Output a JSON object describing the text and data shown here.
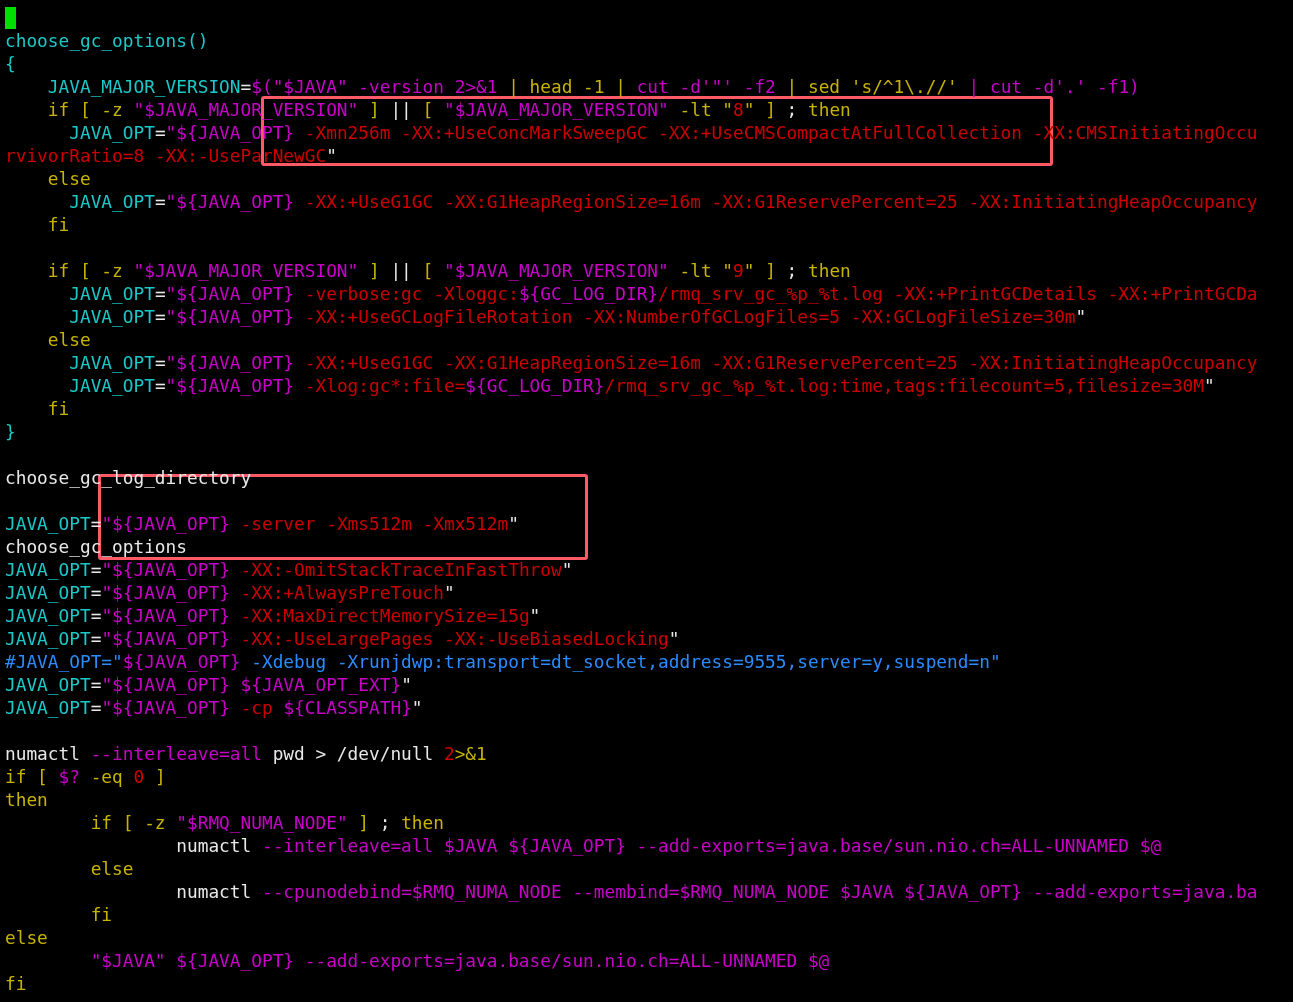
{
  "editor": {
    "cursor_visible": true,
    "lines": [
      {
        "segments": [
          {
            "kind": "fn",
            "text": "choose_gc_options()"
          }
        ]
      },
      {
        "segments": [
          {
            "kind": "fn",
            "text": "{"
          }
        ]
      },
      {
        "segments": [
          {
            "kind": "ident",
            "text": "    JAVA_MAJOR_VERSION"
          },
          {
            "kind": "op",
            "text": "="
          },
          {
            "kind": "str",
            "text": "$(\"$JAVA\" -version 2>&1"
          },
          {
            "kind": "kw",
            "text": " | head -1 | "
          },
          {
            "kind": "str",
            "text": "cut -d'\"' -f2 "
          },
          {
            "kind": "kw",
            "text": "| sed 's/^1\\.//' "
          },
          {
            "kind": "str",
            "text": "| cut -d'.' -f1)"
          }
        ]
      },
      {
        "segments": [
          {
            "kind": "kw",
            "text": "    if [ -z "
          },
          {
            "kind": "str",
            "text": "\"$JAVA_MAJOR_VERSION\""
          },
          {
            "kind": "kw",
            "text": " ] "
          },
          {
            "kind": "op",
            "text": "||"
          },
          {
            "kind": "kw",
            "text": " [ "
          },
          {
            "kind": "str",
            "text": "\"$JAVA_MAJOR_VERSION\""
          },
          {
            "kind": "kw",
            "text": " -lt \""
          },
          {
            "kind": "num",
            "text": "8"
          },
          {
            "kind": "kw",
            "text": "\" ] "
          },
          {
            "kind": "op",
            "text": "; "
          },
          {
            "kind": "kw",
            "text": "then"
          }
        ]
      },
      {
        "segments": [
          {
            "kind": "ident",
            "text": "      JAVA_OPT"
          },
          {
            "kind": "op",
            "text": "="
          },
          {
            "kind": "str",
            "text": "\"${JAVA_OPT}"
          },
          {
            "kind": "opt",
            "text": " -Xmn256m -XX:+UseConcMarkSweepGC -XX:+UseCMSCompactAtFullCollection -XX:CMSInitiatingOccu"
          }
        ]
      },
      {
        "segments": [
          {
            "kind": "opt",
            "text": "rvivorRatio=8 -XX:-UseParNewGC"
          },
          {
            "kind": "op",
            "text": "\""
          }
        ]
      },
      {
        "segments": [
          {
            "kind": "kw",
            "text": "    else"
          }
        ]
      },
      {
        "segments": [
          {
            "kind": "ident",
            "text": "      JAVA_OPT"
          },
          {
            "kind": "op",
            "text": "="
          },
          {
            "kind": "str",
            "text": "\"${JAVA_OPT}"
          },
          {
            "kind": "opt",
            "text": " -XX:+UseG1GC -XX:G1HeapRegionSize=16m -XX:G1ReservePercent=25 -XX:InitiatingHeapOccupancy"
          }
        ]
      },
      {
        "segments": [
          {
            "kind": "kw",
            "text": "    fi"
          }
        ]
      },
      {
        "kind": "blank"
      },
      {
        "segments": [
          {
            "kind": "kw",
            "text": "    if [ -z "
          },
          {
            "kind": "str",
            "text": "\"$JAVA_MAJOR_VERSION\""
          },
          {
            "kind": "kw",
            "text": " ] "
          },
          {
            "kind": "op",
            "text": "||"
          },
          {
            "kind": "kw",
            "text": " [ "
          },
          {
            "kind": "str",
            "text": "\"$JAVA_MAJOR_VERSION\""
          },
          {
            "kind": "kw",
            "text": " -lt \""
          },
          {
            "kind": "num",
            "text": "9"
          },
          {
            "kind": "kw",
            "text": "\" ] "
          },
          {
            "kind": "op",
            "text": "; "
          },
          {
            "kind": "kw",
            "text": "then"
          }
        ]
      },
      {
        "segments": [
          {
            "kind": "ident",
            "text": "      JAVA_OPT"
          },
          {
            "kind": "op",
            "text": "="
          },
          {
            "kind": "str",
            "text": "\"${JAVA_OPT}"
          },
          {
            "kind": "opt",
            "text": " -verbose:gc -Xloggc:"
          },
          {
            "kind": "str",
            "text": "${GC_LOG_DIR}"
          },
          {
            "kind": "opt",
            "text": "/rmq_srv_gc_%p_%t.log -XX:+PrintGCDetails -XX:+PrintGCDa"
          }
        ]
      },
      {
        "segments": [
          {
            "kind": "ident",
            "text": "      JAVA_OPT"
          },
          {
            "kind": "op",
            "text": "="
          },
          {
            "kind": "str",
            "text": "\"${JAVA_OPT}"
          },
          {
            "kind": "opt",
            "text": " -XX:+UseGCLogFileRotation -XX:NumberOfGCLogFiles=5 -XX:GCLogFileSize=30m"
          },
          {
            "kind": "op",
            "text": "\""
          }
        ]
      },
      {
        "segments": [
          {
            "kind": "kw",
            "text": "    else"
          }
        ]
      },
      {
        "segments": [
          {
            "kind": "ident",
            "text": "      JAVA_OPT"
          },
          {
            "kind": "op",
            "text": "="
          },
          {
            "kind": "str",
            "text": "\"${JAVA_OPT}"
          },
          {
            "kind": "opt",
            "text": " -XX:+UseG1GC -XX:G1HeapRegionSize=16m -XX:G1ReservePercent=25 -XX:InitiatingHeapOccupancy"
          }
        ]
      },
      {
        "segments": [
          {
            "kind": "ident",
            "text": "      JAVA_OPT"
          },
          {
            "kind": "op",
            "text": "="
          },
          {
            "kind": "str",
            "text": "\"${JAVA_OPT}"
          },
          {
            "kind": "opt",
            "text": " -Xlog:gc*:file="
          },
          {
            "kind": "str",
            "text": "${GC_LOG_DIR}"
          },
          {
            "kind": "opt",
            "text": "/rmq_srv_gc_%p_%t.log:time,tags:filecount=5,filesize=30M"
          },
          {
            "kind": "op",
            "text": "\""
          }
        ]
      },
      {
        "segments": [
          {
            "kind": "kw",
            "text": "    fi"
          }
        ]
      },
      {
        "segments": [
          {
            "kind": "fn",
            "text": "}"
          }
        ]
      },
      {
        "kind": "blank"
      },
      {
        "segments": [
          {
            "kind": "plain",
            "text": "choose_gc_log_directory"
          }
        ]
      },
      {
        "kind": "blank"
      },
      {
        "segments": [
          {
            "kind": "ident",
            "text": "JAVA_OPT"
          },
          {
            "kind": "op",
            "text": "="
          },
          {
            "kind": "str",
            "text": "\"${JAVA_OPT}"
          },
          {
            "kind": "opt",
            "text": " -server -Xms512m -Xmx512m"
          },
          {
            "kind": "op",
            "text": "\""
          }
        ]
      },
      {
        "segments": [
          {
            "kind": "plain",
            "text": "choose_gc_options"
          }
        ]
      },
      {
        "segments": [
          {
            "kind": "ident",
            "text": "JAVA_OPT"
          },
          {
            "kind": "op",
            "text": "="
          },
          {
            "kind": "str",
            "text": "\"${JAVA_OPT}"
          },
          {
            "kind": "opt",
            "text": " -XX:-OmitStackTraceInFastThrow"
          },
          {
            "kind": "op",
            "text": "\""
          }
        ]
      },
      {
        "segments": [
          {
            "kind": "ident",
            "text": "JAVA_OPT"
          },
          {
            "kind": "op",
            "text": "="
          },
          {
            "kind": "str",
            "text": "\"${JAVA_OPT}"
          },
          {
            "kind": "opt",
            "text": " -XX:+AlwaysPreTouch"
          },
          {
            "kind": "op",
            "text": "\""
          }
        ]
      },
      {
        "segments": [
          {
            "kind": "ident",
            "text": "JAVA_OPT"
          },
          {
            "kind": "op",
            "text": "="
          },
          {
            "kind": "str",
            "text": "\"${JAVA_OPT}"
          },
          {
            "kind": "opt",
            "text": " -XX:MaxDirectMemorySize=15g"
          },
          {
            "kind": "op",
            "text": "\""
          }
        ]
      },
      {
        "segments": [
          {
            "kind": "ident",
            "text": "JAVA_OPT"
          },
          {
            "kind": "op",
            "text": "="
          },
          {
            "kind": "str",
            "text": "\"${JAVA_OPT}"
          },
          {
            "kind": "opt",
            "text": " -XX:-UseLargePages -XX:-UseBiasedLocking"
          },
          {
            "kind": "op",
            "text": "\""
          }
        ]
      },
      {
        "segments": [
          {
            "kind": "comment",
            "text": "#JAVA_OPT=\""
          },
          {
            "kind": "str",
            "text": "${JAVA_OPT}"
          },
          {
            "kind": "comment",
            "text": " -Xdebug -Xrunjdwp:transport=dt_socket,address=9555,server=y,suspend=n\""
          }
        ]
      },
      {
        "segments": [
          {
            "kind": "ident",
            "text": "JAVA_OPT"
          },
          {
            "kind": "op",
            "text": "="
          },
          {
            "kind": "str",
            "text": "\"${JAVA_OPT} ${JAVA_OPT_EXT}"
          },
          {
            "kind": "op",
            "text": "\""
          }
        ]
      },
      {
        "segments": [
          {
            "kind": "ident",
            "text": "JAVA_OPT"
          },
          {
            "kind": "op",
            "text": "="
          },
          {
            "kind": "str",
            "text": "\"${JAVA_OPT}"
          },
          {
            "kind": "opt",
            "text": " -cp "
          },
          {
            "kind": "str",
            "text": "${CLASSPATH}"
          },
          {
            "kind": "op",
            "text": "\""
          }
        ]
      },
      {
        "kind": "blank"
      },
      {
        "segments": [
          {
            "kind": "plain",
            "text": "numactl"
          },
          {
            "kind": "str",
            "text": " --interleave=all"
          },
          {
            "kind": "plain",
            "text": " pwd > /dev/null "
          },
          {
            "kind": "num",
            "text": "2"
          },
          {
            "kind": "kw",
            "text": ">&1"
          }
        ]
      },
      {
        "segments": [
          {
            "kind": "kw",
            "text": "if [ "
          },
          {
            "kind": "str",
            "text": "$?"
          },
          {
            "kind": "kw",
            "text": " -eq "
          },
          {
            "kind": "num",
            "text": "0"
          },
          {
            "kind": "kw",
            "text": " ]"
          }
        ]
      },
      {
        "segments": [
          {
            "kind": "kw",
            "text": "then"
          }
        ]
      },
      {
        "segments": [
          {
            "kind": "kw",
            "text": "        if [ -z "
          },
          {
            "kind": "str",
            "text": "\"$RMQ_NUMA_NODE\""
          },
          {
            "kind": "kw",
            "text": " ] "
          },
          {
            "kind": "op",
            "text": "; "
          },
          {
            "kind": "kw",
            "text": "then"
          }
        ]
      },
      {
        "segments": [
          {
            "kind": "plain",
            "text": "                numactl"
          },
          {
            "kind": "str",
            "text": " --interleave=all $JAVA ${JAVA_OPT} --add-exports=java.base/sun.nio.ch=ALL-UNNAMED $@"
          }
        ]
      },
      {
        "segments": [
          {
            "kind": "kw",
            "text": "        else"
          }
        ]
      },
      {
        "segments": [
          {
            "kind": "plain",
            "text": "                numactl"
          },
          {
            "kind": "str",
            "text": " --cpunodebind=$RMQ_NUMA_NODE --membind=$RMQ_NUMA_NODE $JAVA ${JAVA_OPT} --add-exports=java.ba"
          }
        ]
      },
      {
        "segments": [
          {
            "kind": "kw",
            "text": "        fi"
          }
        ]
      },
      {
        "segments": [
          {
            "kind": "kw",
            "text": "else"
          }
        ]
      },
      {
        "segments": [
          {
            "kind": "str",
            "text": "        \"$JAVA\" ${JAVA_OPT} --add-exports=java.base/sun.nio.ch=ALL-UNNAMED $@"
          }
        ]
      },
      {
        "segments": [
          {
            "kind": "kw",
            "text": "fi"
          }
        ]
      }
    ]
  }
}
